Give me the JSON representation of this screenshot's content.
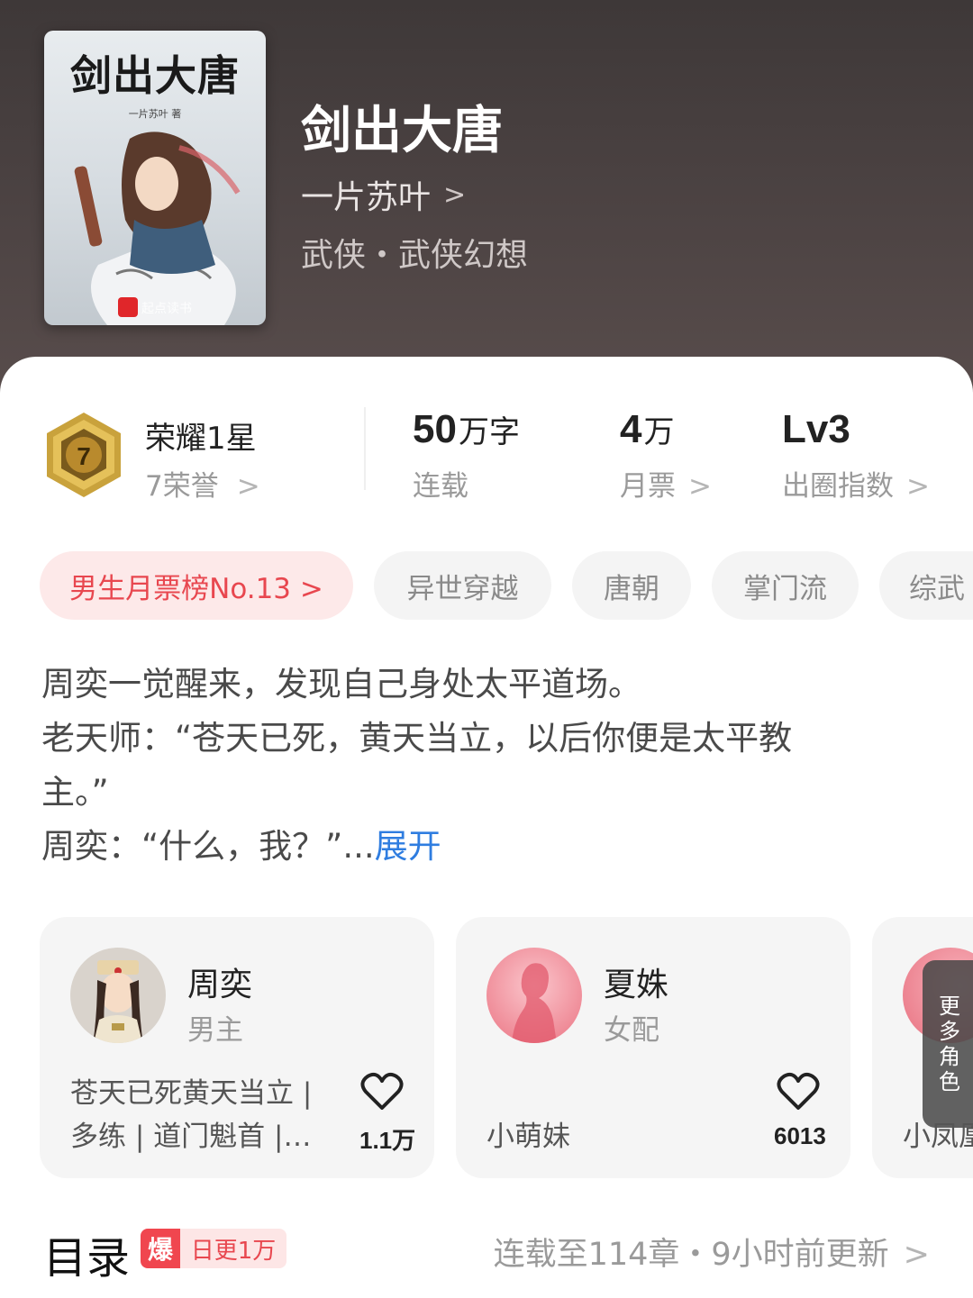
{
  "book": {
    "cover_title": "剑出大唐",
    "cover_author": "一片苏叶 著",
    "cover_brand": "起点读书",
    "title": "剑出大唐",
    "author": "一片苏叶",
    "genre": "武侠・武侠幻想"
  },
  "stats": {
    "honor_title": "荣耀1星",
    "honor_sub": "7荣誉",
    "medal_number": "7",
    "words_value": "50",
    "words_unit": "万字",
    "words_label": "连载",
    "tickets_value": "4",
    "tickets_unit": "万",
    "tickets_label": "月票",
    "circle_value": "Lv3",
    "circle_label": "出圈指数",
    "chevron": ">"
  },
  "tags": [
    "男生月票榜No.13 >",
    "异世穿越",
    "唐朝",
    "掌门流",
    "综武"
  ],
  "synopsis": {
    "line1": "周奕一觉醒来，发现自己身处太平道场。",
    "line2": "老天师：“苍天已死，黄天当立，以后你便是太平教",
    "line3": "主。”",
    "line4": "周奕：“什么，我？”...",
    "expand": "展开"
  },
  "characters": [
    {
      "name": "周奕",
      "role": "男主",
      "desc_line1": "苍天已死黄天当立 |",
      "desc_line2": "多练 | 道门魁首 |…",
      "likes": "1.1万"
    },
    {
      "name": "夏姝",
      "role": "女配",
      "desc_line1": "",
      "desc_line2": "小萌妹",
      "likes": "6013"
    }
  ],
  "more_roles": {
    "label_chars": [
      "更",
      "多",
      "角",
      "色"
    ],
    "partial_name": "小凤凰"
  },
  "catalog": {
    "title": "目录",
    "boom": "爆",
    "daily": "日更1万",
    "update": "连载至114章・9小时前更新"
  },
  "colors": {
    "accent_red": "#e8474f",
    "link_blue": "#2f7de0",
    "header_bg": "#4b4242"
  },
  "icons": [
    "chevron-right-icon",
    "medal-icon",
    "heart-icon"
  ]
}
